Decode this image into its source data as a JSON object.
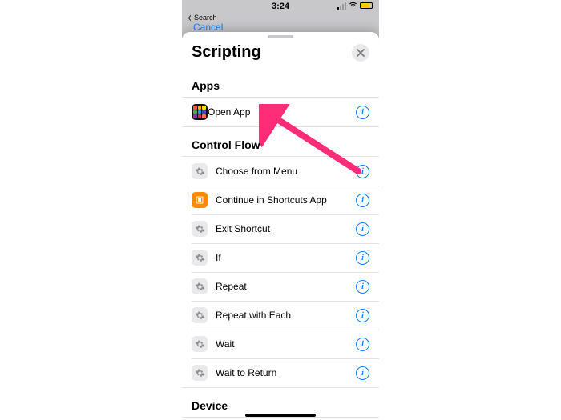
{
  "status": {
    "time": "3:24",
    "back_app": "Search"
  },
  "dimmed": {
    "cancel": "Cancel"
  },
  "sheet": {
    "title": "Scripting"
  },
  "sections": {
    "apps": {
      "header": "Apps",
      "items": [
        {
          "label": "Open App"
        }
      ]
    },
    "control_flow": {
      "header": "Control Flow",
      "items": [
        {
          "label": "Choose from Menu"
        },
        {
          "label": "Continue in Shortcuts App"
        },
        {
          "label": "Exit Shortcut"
        },
        {
          "label": "If"
        },
        {
          "label": "Repeat"
        },
        {
          "label": "Repeat with Each"
        },
        {
          "label": "Wait"
        },
        {
          "label": "Wait to Return"
        }
      ]
    },
    "device": {
      "header": "Device"
    }
  }
}
